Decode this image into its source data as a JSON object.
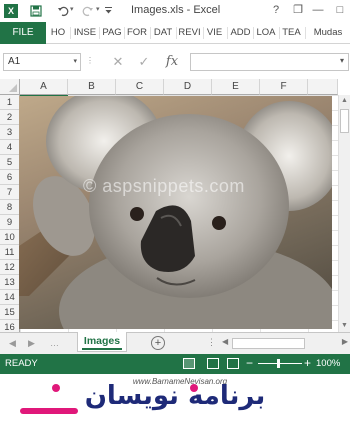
{
  "window": {
    "title": "Images.xls - Excel",
    "logo_letter": "X",
    "controls": {
      "help": "?",
      "restore": "❐",
      "minimize": "—",
      "maximize": "□",
      "close": "✕"
    }
  },
  "quick_access": {
    "save": "💾",
    "undo": "↶",
    "redo": "↷",
    "more": "▾"
  },
  "ribbon": {
    "file": "FILE",
    "tabs": [
      "HO",
      "INSE",
      "PAG",
      "FOR",
      "DAT",
      "REVI",
      "VIE",
      "ADD",
      "LOA",
      "TEA",
      "Mudas"
    ]
  },
  "formula_bar": {
    "name_box": "A1",
    "cancel": "✕",
    "enter": "✓",
    "fx": "fx",
    "value": ""
  },
  "columns": [
    "A",
    "B",
    "C",
    "D",
    "E",
    "F"
  ],
  "rows": [
    "1",
    "2",
    "3",
    "4",
    "5",
    "6",
    "7",
    "8",
    "9",
    "10",
    "11",
    "12",
    "13",
    "14",
    "15",
    "16"
  ],
  "picture": {
    "watermark": "© aspsnippets.com"
  },
  "sheets": {
    "active": "Images",
    "add": "+"
  },
  "status": {
    "ready": "READY",
    "zoom_minus": "−",
    "zoom_plus": "+",
    "zoom": "100%"
  },
  "banner": {
    "url": "www.BarnameNevisan.org",
    "text": "برنامه نویسان"
  },
  "colors": {
    "accent": "#217346",
    "banner_navy": "#1e2a78",
    "banner_pink": "#e0187a"
  }
}
